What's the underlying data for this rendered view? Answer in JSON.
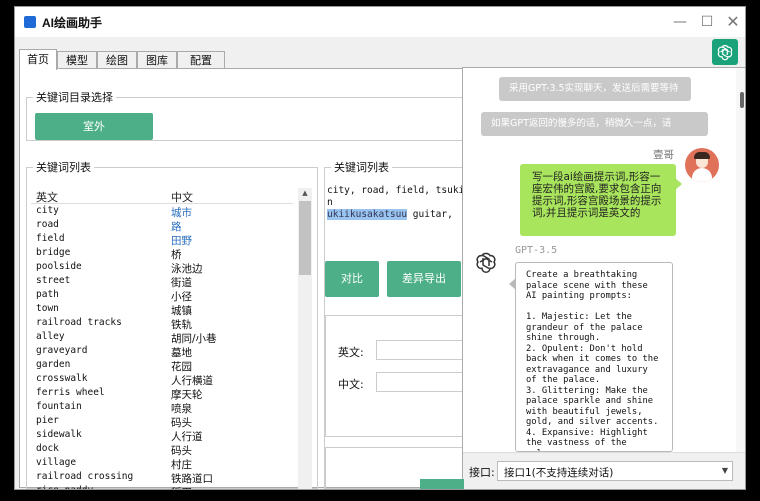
{
  "window": {
    "title": "AI绘画助手"
  },
  "tabs": [
    {
      "label": "首页"
    },
    {
      "label": "模型"
    },
    {
      "label": "绘图"
    },
    {
      "label": "图库"
    },
    {
      "label": "配置"
    }
  ],
  "catalog": {
    "legend": "关键词目录选择",
    "button": "室外"
  },
  "keyword_list": {
    "legend": "关键词列表",
    "col_en": "英文",
    "col_zh": "中文",
    "rows": [
      {
        "en": "city",
        "zh": "城市"
      },
      {
        "en": "road",
        "zh": "路"
      },
      {
        "en": "field",
        "zh": "田野"
      },
      {
        "en": "bridge",
        "zh": "桥"
      },
      {
        "en": "poolside",
        "zh": "泳池边"
      },
      {
        "en": "street",
        "zh": "街道"
      },
      {
        "en": "path",
        "zh": "小径"
      },
      {
        "en": "town",
        "zh": "城镇"
      },
      {
        "en": "railroad tracks",
        "zh": "铁轨"
      },
      {
        "en": "alley",
        "zh": "胡同/小巷"
      },
      {
        "en": "graveyard",
        "zh": "墓地"
      },
      {
        "en": "garden",
        "zh": "花园"
      },
      {
        "en": "crosswalk",
        "zh": "人行横道"
      },
      {
        "en": "ferris wheel",
        "zh": "摩天轮"
      },
      {
        "en": "fountain",
        "zh": "喷泉"
      },
      {
        "en": "pier",
        "zh": "码头"
      },
      {
        "en": "sidewalk",
        "zh": "人行道"
      },
      {
        "en": "dock",
        "zh": "码头"
      },
      {
        "en": "village",
        "zh": "村庄"
      },
      {
        "en": "railroad crossing",
        "zh": "铁路道口"
      },
      {
        "en": "rice paddy",
        "zh": "稻田"
      }
    ]
  },
  "selected_list": {
    "legend": "关键词列表",
    "text_line1": "city, road, field, tsuki n",
    "text_highlight": "ukiikusakatsuu",
    "text_line2_rest": " guitar,",
    "btn_compare": "对比",
    "btn_export": "差异导出",
    "label_en": "英文:",
    "label_zh": "中文:"
  },
  "chat": {
    "system_msg_1": "采用GPT-3.5实现聊天，发送后需要等待",
    "system_msg_2": "如果GPT返回的慢多的话，稍微久一点，请",
    "user_name": "壹哥",
    "user_message": "写一段ai绘画提示词,形容一座宏伟的宫殿,要求包含正向提示词,形容宫殿场景的提示词,并且提示词是英文的",
    "bot_name": "GPT-3.5",
    "bot_message": "Create a breathtaking palace scene with these AI painting prompts:\n\n1. Majestic: Let the grandeur of the palace shine through.\n2. Opulent: Don't hold back when it comes to the extravagance and luxury of the palace.\n3. Glittering: Make the palace sparkle and shine with beautiful jewels, gold, and silver accents.\n4. Expansive: Highlight the vastness of the palace",
    "interface_label": "接口:",
    "interface_value": "接口1(不支持连续对话)"
  },
  "colors": {
    "accent_green": "#4caf87",
    "user_bubble": "#a8e45c",
    "link_blue": "#2b6fbf"
  },
  "icons": {
    "logo": "openai-logo-icon",
    "app": "app-icon"
  }
}
